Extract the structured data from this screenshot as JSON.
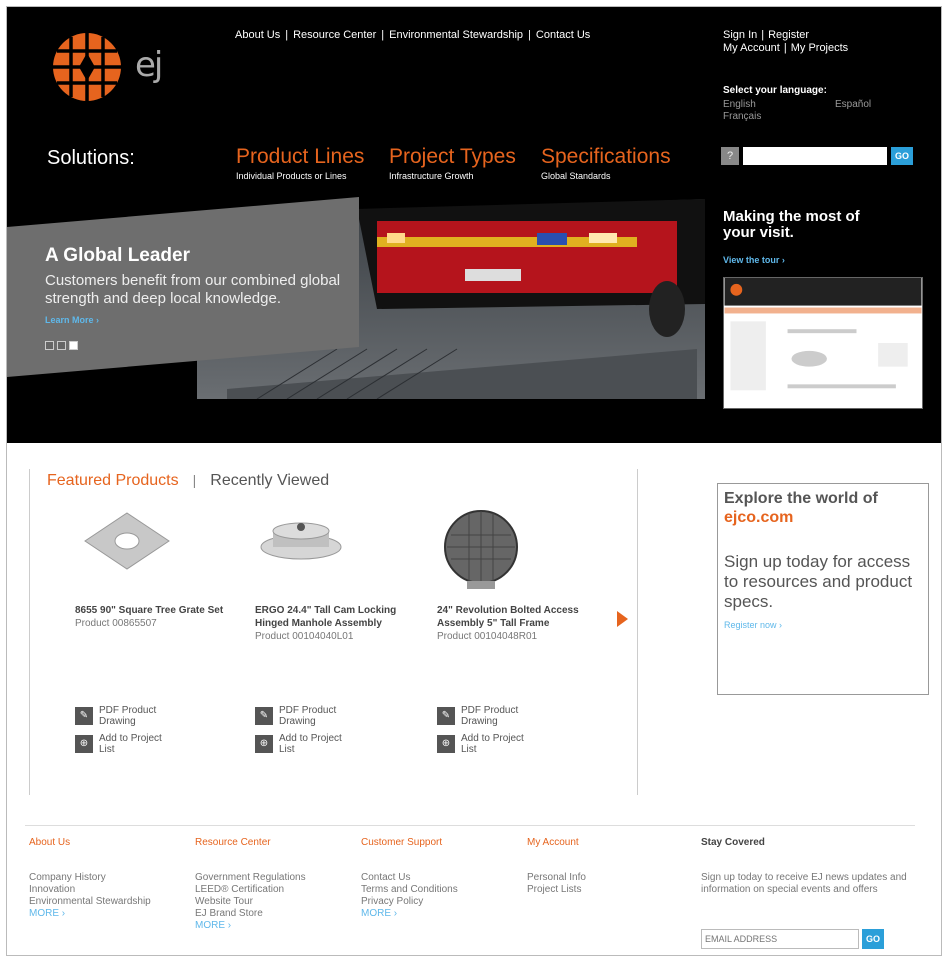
{
  "header": {
    "logo_text": "ej",
    "topnav": [
      "About Us",
      "Resource Center",
      "Environmental Stewardship",
      "Contact Us"
    ],
    "account": {
      "sign_in": "Sign In",
      "register": "Register",
      "my_account": "My Account",
      "my_projects": "My Projects"
    },
    "language": {
      "title": "Select your language:",
      "options": [
        "English",
        "Español",
        "Français"
      ]
    },
    "solutions_label": "Solutions:",
    "solutions": [
      {
        "title": "Product Lines",
        "sub": "Individual Products or Lines"
      },
      {
        "title": "Project Types",
        "sub": "Infrastructure Growth"
      },
      {
        "title": "Specifications",
        "sub": "Global Standards"
      }
    ],
    "search": {
      "help": "?",
      "placeholder": "",
      "go": "GO"
    }
  },
  "hero": {
    "title": "A Global Leader",
    "subtitle": "Customers benefit from our combined global strength and deep local knowledge.",
    "link": "Learn More ›"
  },
  "visit": {
    "title": "Making the most of your visit.",
    "link": "View the tour ›"
  },
  "featured": {
    "tab_active": "Featured Products",
    "tab_inactive": "Recently Viewed",
    "products": [
      {
        "name": "8655 90\" Square Tree Grate Set",
        "sku": "Product 00865507",
        "pdf": "PDF Product Drawing",
        "add": "Add to Project List"
      },
      {
        "name": "ERGO 24.4\" Tall Cam Locking Hinged Manhole Assembly",
        "sku": "Product 00104040L01",
        "pdf": "PDF Product Drawing",
        "add": "Add to Project List"
      },
      {
        "name": "24\" Revolution Bolted Access Assembly 5\" Tall Frame",
        "sku": "Product 00104048R01",
        "pdf": "PDF Product Drawing",
        "add": "Add to Project List"
      }
    ]
  },
  "explore": {
    "line1": "Explore the world of",
    "line2": "ejco.com",
    "line3": "Sign up today for access to resources and product specs.",
    "link": "Register now ›"
  },
  "footer": {
    "about": {
      "heading": "About Us",
      "items": [
        "Company History",
        "Innovation",
        "Environmental Stewardship"
      ],
      "more": "MORE ›"
    },
    "resource": {
      "heading": "Resource Center",
      "items": [
        "Government Regulations",
        "LEED® Certification",
        "Website Tour",
        "EJ Brand Store"
      ],
      "more": "MORE ›"
    },
    "support": {
      "heading": "Customer Support",
      "items": [
        "Contact Us",
        "Terms and Conditions",
        "Privacy Policy"
      ],
      "more": "MORE ›"
    },
    "account": {
      "heading": "My Account",
      "items": [
        "Personal Info",
        "Project Lists"
      ]
    },
    "stay": {
      "heading": "Stay Covered",
      "text": "Sign up today to receive EJ news updates and information on special events and offers",
      "placeholder": "EMAIL ADDRESS",
      "go": "GO"
    }
  }
}
